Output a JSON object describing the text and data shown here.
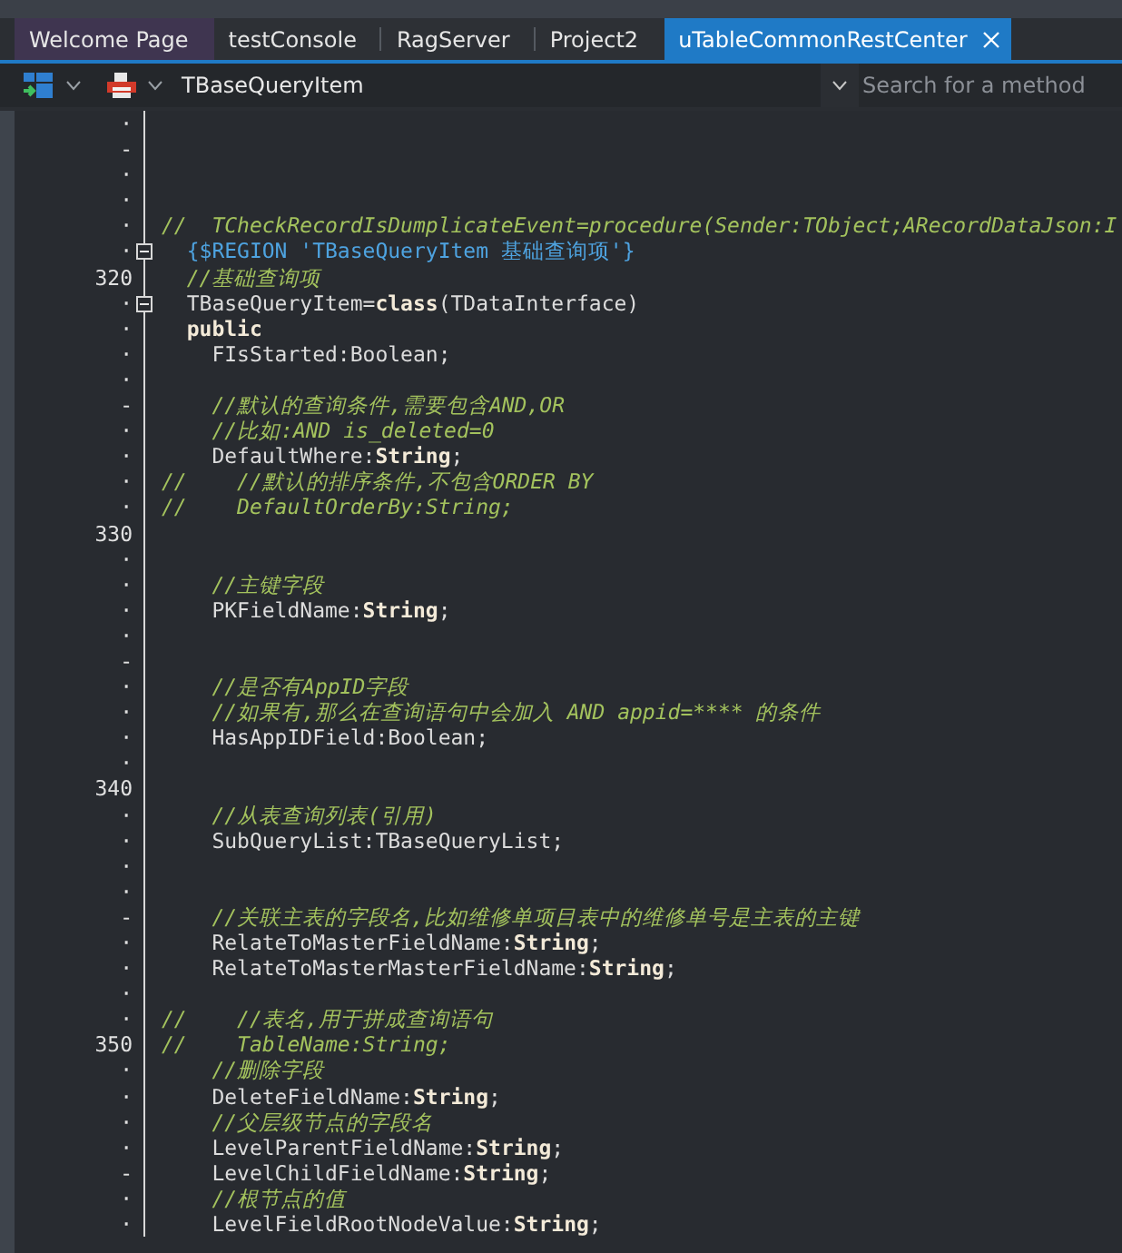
{
  "tabs": [
    {
      "label": "Welcome Page",
      "kind": "start",
      "selected": false
    },
    {
      "label": "testConsole",
      "kind": "document",
      "selected": false
    },
    {
      "label": "RagServer",
      "kind": "document",
      "selected": false
    },
    {
      "label": "Project2",
      "kind": "document",
      "selected": false
    },
    {
      "label": "uTableCommonRestCenter",
      "kind": "document",
      "selected": true
    }
  ],
  "toolbar": {
    "class_selector": "TBaseQueryItem",
    "method_search": {
      "placeholder": "Search for a method"
    }
  },
  "editor": {
    "lines": [
      {
        "gutter": "·",
        "fold": false
      },
      {
        "gutter": "-",
        "fold": false
      },
      {
        "gutter": "·",
        "fold": false
      },
      {
        "gutter": "·",
        "fold": false
      },
      {
        "gutter": "·",
        "fold": false,
        "tokens": [
          {
            "kind": "comment",
            "text": "//  TCheckRecordIsDumplicateEvent=procedure(Sender:TObject;ARecordDataJson:I"
          }
        ]
      },
      {
        "gutter": "·",
        "fold": true,
        "tokens": [
          {
            "kind": "directive",
            "text": "  {$REGION 'TBaseQueryItem 基础查询项'}"
          }
        ]
      },
      {
        "gutter": "320",
        "fold": false,
        "tokens": [
          {
            "kind": "comment",
            "text": "  //基础查询项"
          }
        ]
      },
      {
        "gutter": "·",
        "fold": true,
        "tokens": [
          {
            "kind": "plain",
            "text": "  TBaseQueryItem="
          },
          {
            "kind": "keyword",
            "text": "class"
          },
          {
            "kind": "plain",
            "text": "(TDataInterface)"
          }
        ]
      },
      {
        "gutter": "·",
        "fold": false,
        "tokens": [
          {
            "kind": "keyword",
            "text": "  public"
          }
        ]
      },
      {
        "gutter": "·",
        "fold": false,
        "tokens": [
          {
            "kind": "plain",
            "text": "    FIsStarted:Boolean;"
          }
        ]
      },
      {
        "gutter": "·",
        "fold": false
      },
      {
        "gutter": "-",
        "fold": false,
        "tokens": [
          {
            "kind": "comment",
            "text": "    //默认的查询条件,需要包含AND,OR"
          }
        ]
      },
      {
        "gutter": "·",
        "fold": false,
        "tokens": [
          {
            "kind": "comment",
            "text": "    //比如:AND is_deleted=0"
          }
        ]
      },
      {
        "gutter": "·",
        "fold": false,
        "tokens": [
          {
            "kind": "plain",
            "text": "    DefaultWhere:"
          },
          {
            "kind": "keyword",
            "text": "String"
          },
          {
            "kind": "plain",
            "text": ";"
          }
        ]
      },
      {
        "gutter": "·",
        "fold": false,
        "tokens": [
          {
            "kind": "comment",
            "text": "//    //默认的排序条件,不包含ORDER BY"
          }
        ]
      },
      {
        "gutter": "·",
        "fold": false,
        "tokens": [
          {
            "kind": "comment",
            "text": "//    DefaultOrderBy:String;"
          }
        ]
      },
      {
        "gutter": "330",
        "fold": false
      },
      {
        "gutter": "·",
        "fold": false
      },
      {
        "gutter": "·",
        "fold": false,
        "tokens": [
          {
            "kind": "comment",
            "text": "    //主键字段"
          }
        ]
      },
      {
        "gutter": "·",
        "fold": false,
        "tokens": [
          {
            "kind": "plain",
            "text": "    PKFieldName:"
          },
          {
            "kind": "keyword",
            "text": "String"
          },
          {
            "kind": "plain",
            "text": ";"
          }
        ]
      },
      {
        "gutter": "·",
        "fold": false
      },
      {
        "gutter": "-",
        "fold": false
      },
      {
        "gutter": "·",
        "fold": false,
        "tokens": [
          {
            "kind": "comment",
            "text": "    //是否有AppID字段"
          }
        ]
      },
      {
        "gutter": "·",
        "fold": false,
        "tokens": [
          {
            "kind": "comment",
            "text": "    //如果有,那么在查询语句中会加入 AND appid=**** 的条件"
          }
        ]
      },
      {
        "gutter": "·",
        "fold": false,
        "tokens": [
          {
            "kind": "plain",
            "text": "    HasAppIDField:Boolean;"
          }
        ]
      },
      {
        "gutter": "·",
        "fold": false
      },
      {
        "gutter": "340",
        "fold": false
      },
      {
        "gutter": "·",
        "fold": false,
        "tokens": [
          {
            "kind": "comment",
            "text": "    //从表查询列表(引用)"
          }
        ]
      },
      {
        "gutter": "·",
        "fold": false,
        "tokens": [
          {
            "kind": "plain",
            "text": "    SubQueryList:TBaseQueryList;"
          }
        ]
      },
      {
        "gutter": "·",
        "fold": false
      },
      {
        "gutter": "·",
        "fold": false
      },
      {
        "gutter": "-",
        "fold": false,
        "tokens": [
          {
            "kind": "comment",
            "text": "    //关联主表的字段名,比如维修单项目表中的维修单号是主表的主键"
          }
        ]
      },
      {
        "gutter": "·",
        "fold": false,
        "tokens": [
          {
            "kind": "plain",
            "text": "    RelateToMasterFieldName:"
          },
          {
            "kind": "keyword",
            "text": "String"
          },
          {
            "kind": "plain",
            "text": ";"
          }
        ]
      },
      {
        "gutter": "·",
        "fold": false,
        "tokens": [
          {
            "kind": "plain",
            "text": "    RelateToMasterMasterFieldName:"
          },
          {
            "kind": "keyword",
            "text": "String"
          },
          {
            "kind": "plain",
            "text": ";"
          }
        ]
      },
      {
        "gutter": "·",
        "fold": false
      },
      {
        "gutter": "·",
        "fold": false,
        "tokens": [
          {
            "kind": "comment",
            "text": "//    //表名,用于拼成查询语句"
          }
        ]
      },
      {
        "gutter": "350",
        "fold": false,
        "tokens": [
          {
            "kind": "comment",
            "text": "//    TableName:String;"
          }
        ]
      },
      {
        "gutter": "·",
        "fold": false,
        "tokens": [
          {
            "kind": "comment",
            "text": "    //删除字段"
          }
        ]
      },
      {
        "gutter": "·",
        "fold": false,
        "tokens": [
          {
            "kind": "plain",
            "text": "    DeleteFieldName:"
          },
          {
            "kind": "keyword",
            "text": "String"
          },
          {
            "kind": "plain",
            "text": ";"
          }
        ]
      },
      {
        "gutter": "·",
        "fold": false,
        "tokens": [
          {
            "kind": "comment",
            "text": "    //父层级节点的字段名"
          }
        ]
      },
      {
        "gutter": "·",
        "fold": false,
        "tokens": [
          {
            "kind": "plain",
            "text": "    LevelParentFieldName:"
          },
          {
            "kind": "keyword",
            "text": "String"
          },
          {
            "kind": "plain",
            "text": ";"
          }
        ]
      },
      {
        "gutter": "-",
        "fold": false,
        "tokens": [
          {
            "kind": "plain",
            "text": "    LevelChildFieldName:"
          },
          {
            "kind": "keyword",
            "text": "String"
          },
          {
            "kind": "plain",
            "text": ";"
          }
        ]
      },
      {
        "gutter": "·",
        "fold": false,
        "tokens": [
          {
            "kind": "comment",
            "text": "    //根节点的值"
          }
        ]
      },
      {
        "gutter": "·",
        "fold": false,
        "tokens": [
          {
            "kind": "plain",
            "text": "    LevelFieldRootNodeValue:"
          },
          {
            "kind": "keyword",
            "text": "String"
          },
          {
            "kind": "plain",
            "text": ";"
          }
        ]
      }
    ]
  }
}
